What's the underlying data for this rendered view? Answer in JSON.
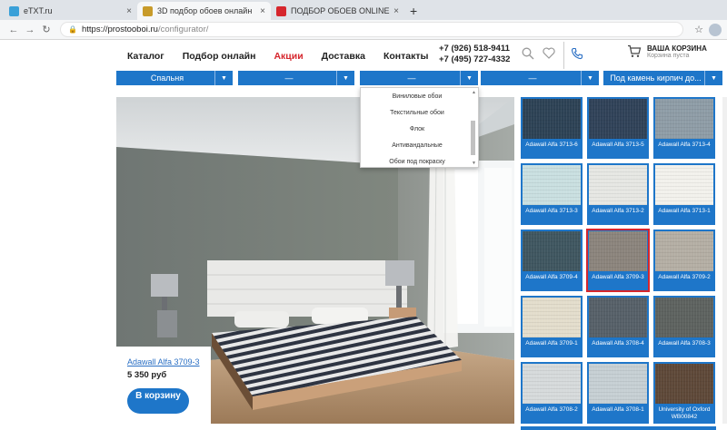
{
  "browser": {
    "tabs": [
      {
        "title": "eTXT.ru",
        "favicon_color": "#3aa0d8",
        "active": false
      },
      {
        "title": "3D подбор обоев онлайн",
        "favicon_color": "#c89b2a",
        "active": true
      },
      {
        "title": "ПОДБОР ОБОЕВ ONLINE",
        "favicon_color": "#d6262d",
        "active": false
      }
    ],
    "close_glyph": "×",
    "new_tab_glyph": "+",
    "url_host": "https://prostooboi.ru",
    "url_path": "/configurator/"
  },
  "header": {
    "menu": [
      {
        "label": "Каталог",
        "promo": false
      },
      {
        "label": "Подбор онлайн",
        "promo": false
      },
      {
        "label": "Акции",
        "promo": true
      },
      {
        "label": "Доставка",
        "promo": false
      },
      {
        "label": "Контакты",
        "promo": false
      }
    ],
    "phone1": "+7 (926) 518-9411",
    "phone2": "+7 (495) 727-4332",
    "cart_title": "ВАША КОРЗИНА",
    "cart_status": "Корзина пуста"
  },
  "filters": [
    {
      "label": "Спальня"
    },
    {
      "label": "—"
    },
    {
      "label": "—"
    },
    {
      "label": "—"
    },
    {
      "label": "Под камень кирпич до..."
    }
  ],
  "dropdown_options": [
    "Виниловые обои",
    "Текстильные обои",
    "Флок",
    "Антивандальные",
    "Обои под покраску"
  ],
  "selected_product": {
    "name": "Adawall Alfa 3709-3",
    "price": "5 350 руб",
    "cart_button": "В корзину"
  },
  "swatches": [
    {
      "name": "Adawall Alfa 3713-6",
      "color": "#2d4255",
      "selected": false
    },
    {
      "name": "Adawall Alfa 3713-5",
      "color": "#304258",
      "selected": false
    },
    {
      "name": "Adawall Alfa 3713-4",
      "color": "#8e9ca6",
      "selected": false
    },
    {
      "name": "Adawall Alfa 3713-3",
      "color": "#c9dfe0",
      "selected": false
    },
    {
      "name": "Adawall Alfa 3713-2",
      "color": "#e6e7e3",
      "selected": false
    },
    {
      "name": "Adawall Alfa 3713-1",
      "color": "#f2f1ec",
      "selected": false
    },
    {
      "name": "Adawall Alfa 3709-4",
      "color": "#3f5660",
      "selected": false
    },
    {
      "name": "Adawall Alfa 3709-3",
      "color": "#8b847c",
      "selected": true
    },
    {
      "name": "Adawall Alfa 3709-2",
      "color": "#b4aea4",
      "selected": false
    },
    {
      "name": "Adawall Alfa 3709-1",
      "color": "#e3ddcc",
      "selected": false
    },
    {
      "name": "Adawall Alfa 3708-4",
      "color": "#566068",
      "selected": false
    },
    {
      "name": "Adawall Alfa 3708-3",
      "color": "#5d625f",
      "selected": false
    },
    {
      "name": "Adawall Alfa 3708-2",
      "color": "#d6dadb",
      "selected": false
    },
    {
      "name": "Adawall Alfa 3708-1",
      "color": "#c6cfd3",
      "selected": false
    },
    {
      "name": "University of Oxford WB00842",
      "color": "#5e4838",
      "selected": false
    }
  ],
  "icons": {
    "search": "search-icon",
    "wishlist": "heart-icon",
    "phone": "phone-icon",
    "cart": "cart-icon",
    "dropdown_arrow": "chevron-down-icon"
  }
}
